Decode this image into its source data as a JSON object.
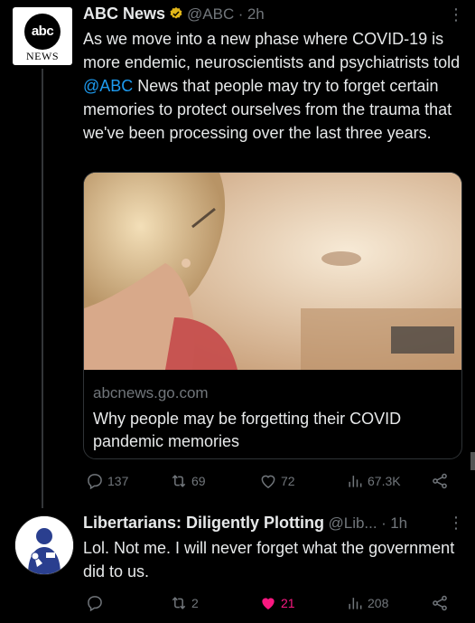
{
  "tweet1": {
    "avatar_top": "abc",
    "avatar_bottom": "NEWS",
    "name": "ABC News",
    "handle": "@ABC",
    "dot": "·",
    "time": "2h",
    "more": "⋮",
    "text_before": "As we move into a new phase where COVID-19 is more endemic, neuroscientists and psychiatrists told ",
    "mention": "@ABC",
    "text_after": " News that people may try to forget certain memories to protect ourselves from the trauma that we've been processing over the last three years.",
    "card": {
      "domain": "abcnews.go.com",
      "title": "Why people may be forgetting their COVID pandemic memories"
    },
    "actions": {
      "replies": "137",
      "retweets": "69",
      "likes": "72",
      "views": "67.3K"
    }
  },
  "tweet2": {
    "name": "Libertarians: Diligently Plotting",
    "handle": "@Lib...",
    "dot": "·",
    "time": "1h",
    "more": "⋮",
    "text": "Lol. Not me. I will never forget what the government did to us.",
    "actions": {
      "replies": "",
      "retweets": "2",
      "likes": "21",
      "views": "208"
    }
  },
  "colors": {
    "background": "#000000",
    "text": "#e7e9ea",
    "muted": "#71767b",
    "link": "#1d9bf0",
    "like_active": "#f91880",
    "verified": "#e2b719"
  }
}
